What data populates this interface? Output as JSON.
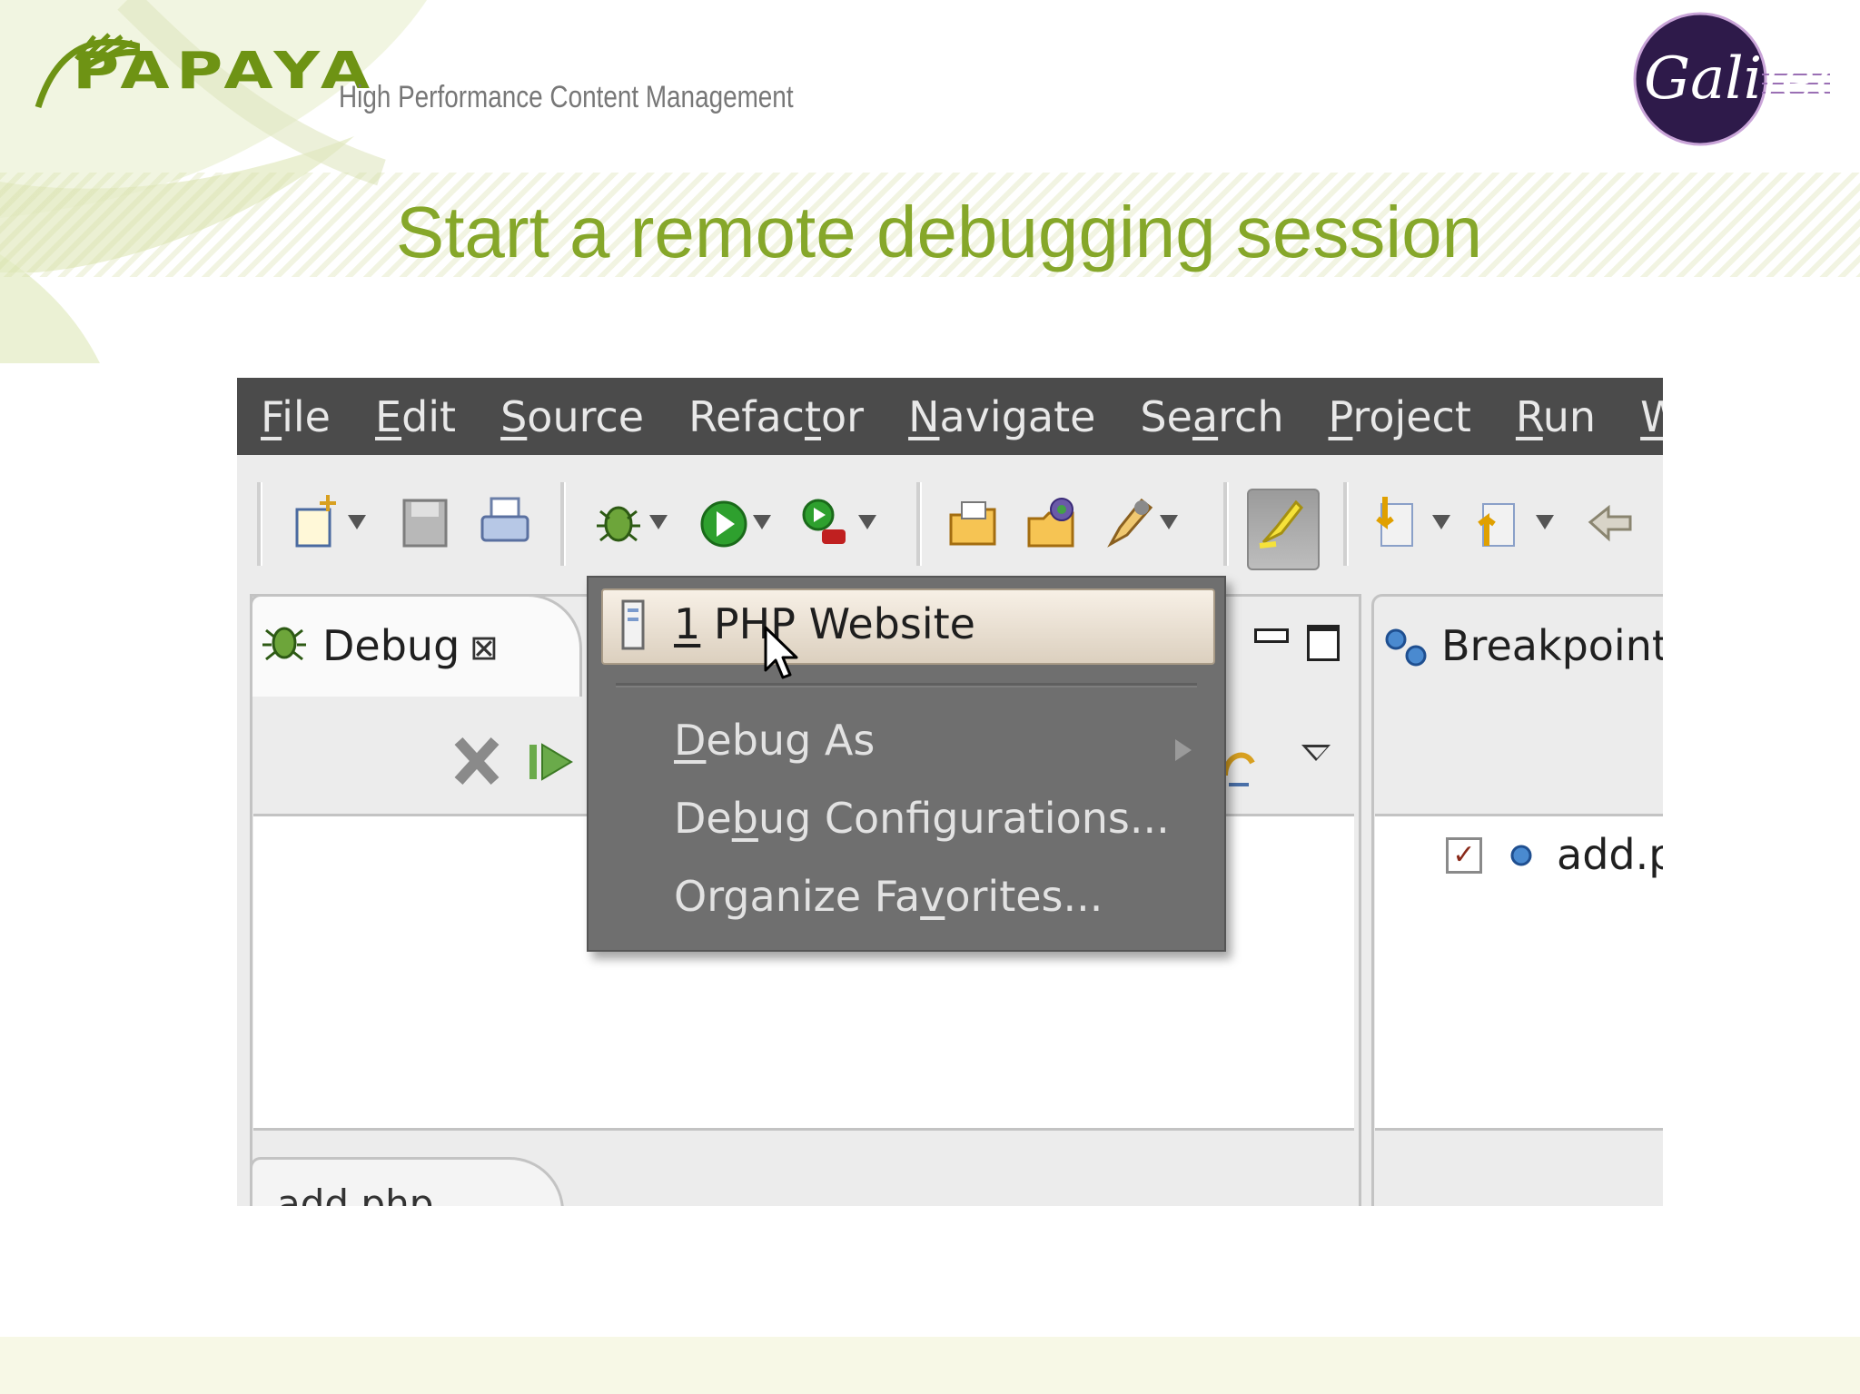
{
  "slide": {
    "logo_text": "PAPAYA",
    "tagline": "High Performance Content Management",
    "title": "Start a remote debugging session",
    "corner_badge_text": "Galileo",
    "colors": {
      "title": "#86a72a",
      "logo": "#6e9314",
      "badge": "#2e1a4a"
    }
  },
  "menubar": {
    "items": [
      {
        "mnemonic": "F",
        "rest": "ile"
      },
      {
        "mnemonic": "E",
        "rest": "dit"
      },
      {
        "mnemonic": "S",
        "rest": "ource"
      },
      {
        "pre": "Refac",
        "mnemonic": "t",
        "rest": "or"
      },
      {
        "mnemonic": "N",
        "rest": "avigate"
      },
      {
        "pre": "Se",
        "mnemonic": "a",
        "rest": "rch"
      },
      {
        "mnemonic": "P",
        "rest": "roject"
      },
      {
        "mnemonic": "R",
        "rest": "un"
      },
      {
        "mnemonic": "W",
        "rest": "ind"
      }
    ]
  },
  "toolbar": {
    "icons": [
      "new-wizard-icon",
      "save-icon",
      "print-icon",
      "debug-bug-icon",
      "run-icon",
      "run-external-icon",
      "open-folder-icon",
      "open-type-icon",
      "search-pen-icon",
      "highlight-icon",
      "next-annotation-icon",
      "previous-annotation-icon",
      "back-icon"
    ]
  },
  "debug_view": {
    "tab_label": "Debug",
    "close_glyph": "⊠"
  },
  "breakpoints_view": {
    "tab_label": "Breakpoints",
    "item_label": "add.p",
    "item_checked": true
  },
  "editor": {
    "tab_label": "add.php"
  },
  "dropdown": {
    "first_item": {
      "num": "1",
      "label": " PHP Website"
    },
    "items": [
      {
        "pre": "",
        "mnemonic": "D",
        "rest": "ebug As",
        "has_submenu": true
      },
      {
        "pre": "De",
        "mnemonic": "b",
        "rest": "ug Configurations..."
      },
      {
        "pre": "Organize Fa",
        "mnemonic": "v",
        "rest": "orites..."
      }
    ]
  }
}
